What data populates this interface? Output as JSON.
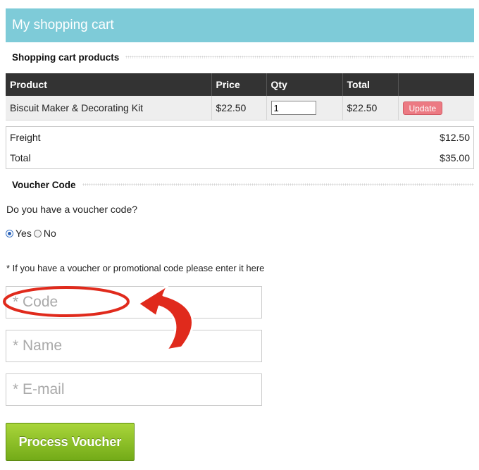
{
  "header": {
    "title": "My shopping cart"
  },
  "cart_section": {
    "title": "Shopping cart products"
  },
  "cart_table": {
    "columns": [
      "Product",
      "Price",
      "Qty",
      "Total",
      ""
    ],
    "rows": [
      {
        "product": "Biscuit Maker & Decorating Kit",
        "price": "$22.50",
        "qty": "1",
        "total": "$22.50",
        "action": "Update"
      }
    ]
  },
  "totals": {
    "freight_label": "Freight",
    "freight_value": "$12.50",
    "total_label": "Total",
    "total_value": "$35.00"
  },
  "voucher_section": {
    "title": "Voucher Code",
    "question": "Do you have a voucher code?",
    "options": [
      {
        "label": "Yes",
        "selected": true
      },
      {
        "label": "No",
        "selected": false
      }
    ],
    "note": "* If you have a voucher or promotional code please enter it here",
    "code_placeholder": "* Code",
    "name_placeholder": "* Name",
    "email_placeholder": "* E-mail",
    "submit_label": "Process Voucher"
  },
  "annotation": {
    "type": "red circle and arrow pointing to code field",
    "color": "#e02a1c"
  },
  "colors": {
    "header_bg": "#7ecbd8",
    "table_header_bg": "#333333",
    "update_button": "#ec7a83",
    "submit_button": "#8cc225"
  }
}
